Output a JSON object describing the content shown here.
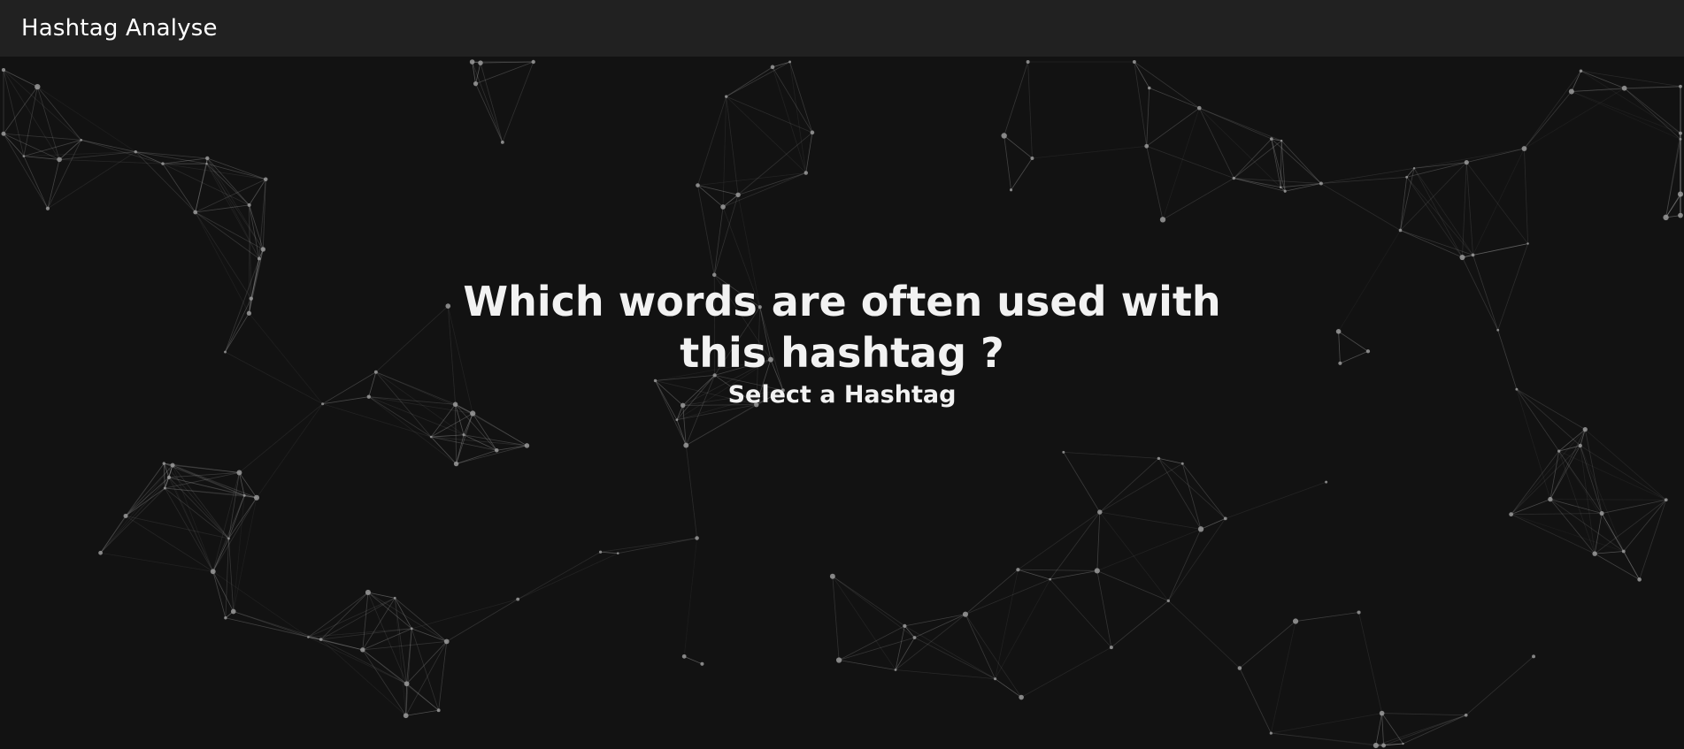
{
  "header": {
    "title": "Hashtag Analyse"
  },
  "hero": {
    "headline": "Which words are often used with this hashtag ?",
    "prompt": "Select a Hashtag"
  },
  "theme": {
    "background": "#121212",
    "topbar": "#212121",
    "text": "#f2f2f2",
    "particle": "#9a9a9a"
  }
}
